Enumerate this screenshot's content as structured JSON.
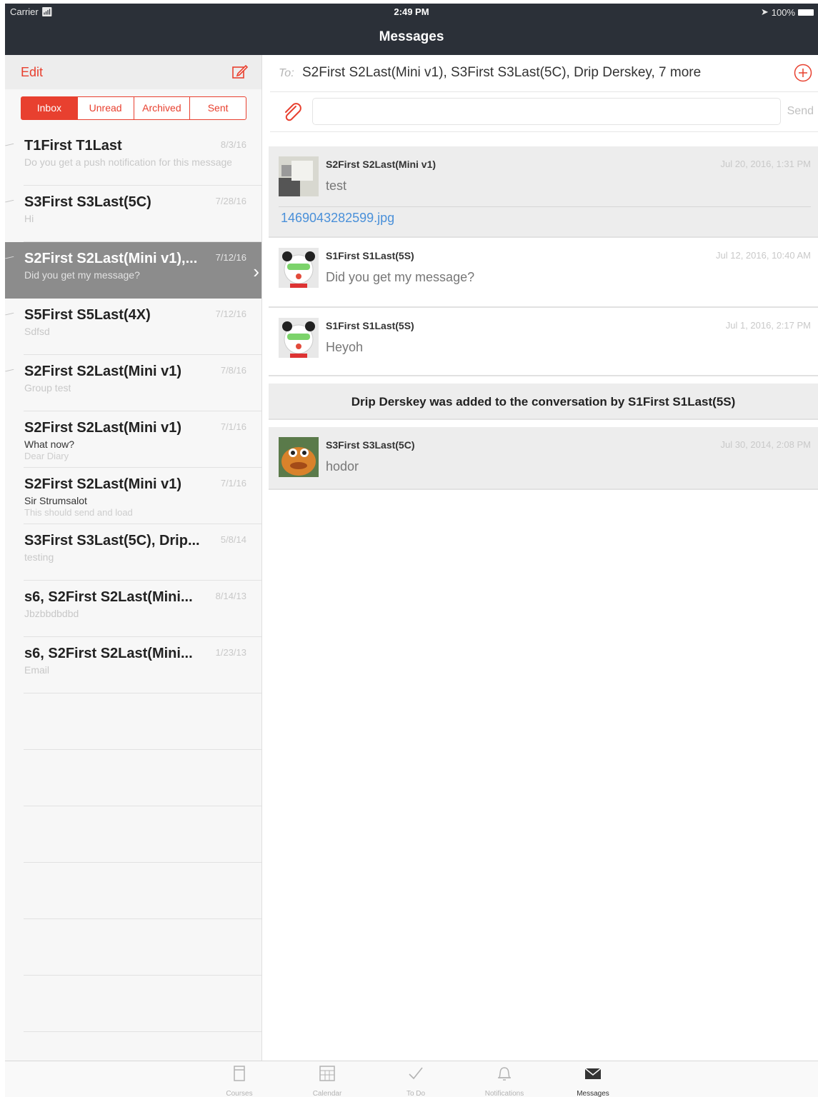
{
  "status_bar": {
    "carrier": "Carrier",
    "time": "2:49 PM",
    "battery": "100%"
  },
  "nav": {
    "title": "Messages"
  },
  "left": {
    "edit_label": "Edit",
    "segments": [
      "Inbox",
      "Unread",
      "Archived",
      "Sent"
    ],
    "conversations": [
      {
        "name": "T1First T1Last",
        "date": "8/3/16",
        "preview": "Do you get a push notification for this message?",
        "subtitle": ""
      },
      {
        "name": "S3First S3Last(5C)",
        "date": "7/28/16",
        "preview": "Hi",
        "subtitle": ""
      },
      {
        "name": "S2First S2Last(Mini v1),...",
        "date": "7/12/16",
        "preview": "Did you get my message?",
        "subtitle": ""
      },
      {
        "name": "S5First S5Last(4X)",
        "date": "7/12/16",
        "preview": "Sdfsd",
        "subtitle": ""
      },
      {
        "name": "S2First S2Last(Mini v1)",
        "date": "7/8/16",
        "preview": "Group test",
        "subtitle": ""
      },
      {
        "name": "S2First S2Last(Mini v1)",
        "date": "7/1/16",
        "preview": "What now?",
        "subtitle": "Dear Diary"
      },
      {
        "name": "S2First S2Last(Mini v1)",
        "date": "7/1/16",
        "preview": "Sir Strumsalot",
        "subtitle": "This should send and load"
      },
      {
        "name": "S3First S3Last(5C), Drip...",
        "date": "5/8/14",
        "preview": "testing",
        "subtitle": ""
      },
      {
        "name": "s6, S2First S2Last(Mini...",
        "date": "8/14/13",
        "preview": "Jbzbbdbdbd",
        "subtitle": ""
      },
      {
        "name": "s6, S2First S2Last(Mini...",
        "date": "1/23/13",
        "preview": "Email",
        "subtitle": ""
      }
    ]
  },
  "right": {
    "to_label": "To:",
    "to_names": "S2First S2Last(Mini v1), S3First S3Last(5C), Drip Derskey, 7 more",
    "message_placeholder": "",
    "send_label": "Send",
    "messages": [
      {
        "author": "S2First S2Last(Mini v1)",
        "time": "Jul 20, 2016, 1:31 PM",
        "body": "test",
        "attachment": "1469043282599.jpg"
      },
      {
        "author": "S1First S1Last(5S)",
        "time": "Jul 12, 2016, 10:40 AM",
        "body": "Did you get my message?"
      },
      {
        "author": "S1First S1Last(5S)",
        "time": "Jul 1, 2016, 2:17 PM",
        "body": "Heyoh"
      },
      {
        "author": "S3First S3Last(5C)",
        "time": "Jul 30, 2014, 2:08 PM",
        "body": "hodor"
      }
    ],
    "system_message": "Drip Derskey was added to the conversation by S1First S1Last(5S)"
  },
  "tabbar": {
    "tabs": [
      {
        "label": "Courses",
        "icon": "courses-icon"
      },
      {
        "label": "Calendar",
        "icon": "calendar-icon"
      },
      {
        "label": "To Do",
        "icon": "checkmark-icon"
      },
      {
        "label": "Notifications",
        "icon": "bell-icon"
      },
      {
        "label": "Messages",
        "icon": "envelope-icon"
      }
    ]
  },
  "colors": {
    "accent": "#e8402f",
    "navbar": "#2b3038",
    "link": "#4a90d9"
  }
}
